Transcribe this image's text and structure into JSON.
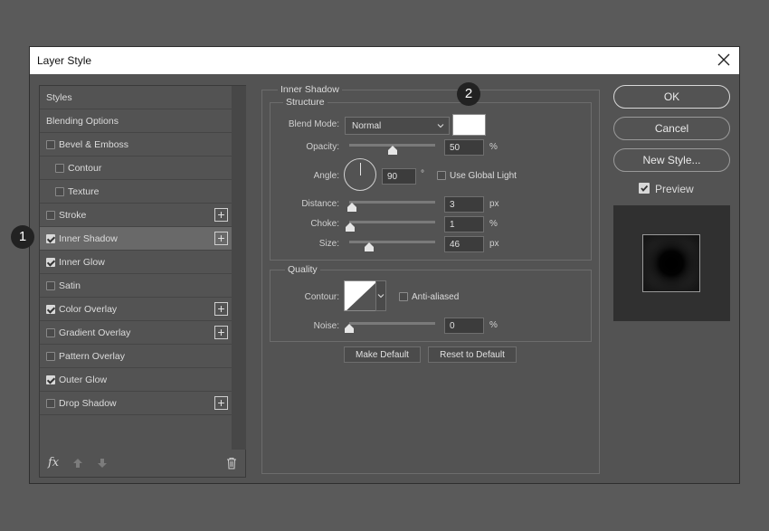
{
  "dialog": {
    "title": "Layer Style"
  },
  "styles_list": {
    "items": [
      {
        "label": "Styles",
        "checkbox": false,
        "checked": false,
        "plus": false,
        "selected": false,
        "indent": false
      },
      {
        "label": "Blending Options",
        "checkbox": false,
        "checked": false,
        "plus": false,
        "selected": false,
        "indent": false
      },
      {
        "label": "Bevel & Emboss",
        "checkbox": true,
        "checked": false,
        "plus": false,
        "selected": false,
        "indent": false
      },
      {
        "label": "Contour",
        "checkbox": true,
        "checked": false,
        "plus": false,
        "selected": false,
        "indent": true
      },
      {
        "label": "Texture",
        "checkbox": true,
        "checked": false,
        "plus": false,
        "selected": false,
        "indent": true
      },
      {
        "label": "Stroke",
        "checkbox": true,
        "checked": false,
        "plus": true,
        "selected": false,
        "indent": false
      },
      {
        "label": "Inner Shadow",
        "checkbox": true,
        "checked": true,
        "plus": true,
        "selected": true,
        "indent": false
      },
      {
        "label": "Inner Glow",
        "checkbox": true,
        "checked": true,
        "plus": false,
        "selected": false,
        "indent": false
      },
      {
        "label": "Satin",
        "checkbox": true,
        "checked": false,
        "plus": false,
        "selected": false,
        "indent": false
      },
      {
        "label": "Color Overlay",
        "checkbox": true,
        "checked": true,
        "plus": true,
        "selected": false,
        "indent": false
      },
      {
        "label": "Gradient Overlay",
        "checkbox": true,
        "checked": false,
        "plus": true,
        "selected": false,
        "indent": false
      },
      {
        "label": "Pattern Overlay",
        "checkbox": true,
        "checked": false,
        "plus": false,
        "selected": false,
        "indent": false
      },
      {
        "label": "Outer Glow",
        "checkbox": true,
        "checked": true,
        "plus": false,
        "selected": false,
        "indent": false
      },
      {
        "label": "Drop Shadow",
        "checkbox": true,
        "checked": false,
        "plus": true,
        "selected": false,
        "indent": false
      }
    ],
    "footer": {
      "fx_label": "fx"
    }
  },
  "inner_shadow": {
    "section_title": "Inner Shadow",
    "structure_title": "Structure",
    "blend_mode": {
      "label": "Blend Mode:",
      "value": "Normal",
      "color": "#ffffff"
    },
    "opacity": {
      "label": "Opacity:",
      "value": "50",
      "unit": "%",
      "slider_fraction": 0.5
    },
    "angle": {
      "label": "Angle:",
      "value": "90",
      "unit": "°",
      "global_light_label": "Use Global Light",
      "global_light_checked": false
    },
    "distance": {
      "label": "Distance:",
      "value": "3",
      "unit": "px",
      "slider_fraction": 0.03
    },
    "choke": {
      "label": "Choke:",
      "value": "1",
      "unit": "%",
      "slider_fraction": 0.01
    },
    "size": {
      "label": "Size:",
      "value": "46",
      "unit": "px",
      "slider_fraction": 0.23
    },
    "quality_title": "Quality",
    "contour": {
      "label": "Contour:",
      "anti_aliased_label": "Anti-aliased",
      "anti_aliased_checked": false
    },
    "noise": {
      "label": "Noise:",
      "value": "0",
      "unit": "%",
      "slider_fraction": 0.0
    },
    "make_default_label": "Make Default",
    "reset_default_label": "Reset to Default"
  },
  "actions": {
    "ok_label": "OK",
    "cancel_label": "Cancel",
    "new_style_label": "New Style...",
    "preview_label": "Preview",
    "preview_checked": true
  },
  "callouts": {
    "one": "1",
    "two": "2"
  }
}
